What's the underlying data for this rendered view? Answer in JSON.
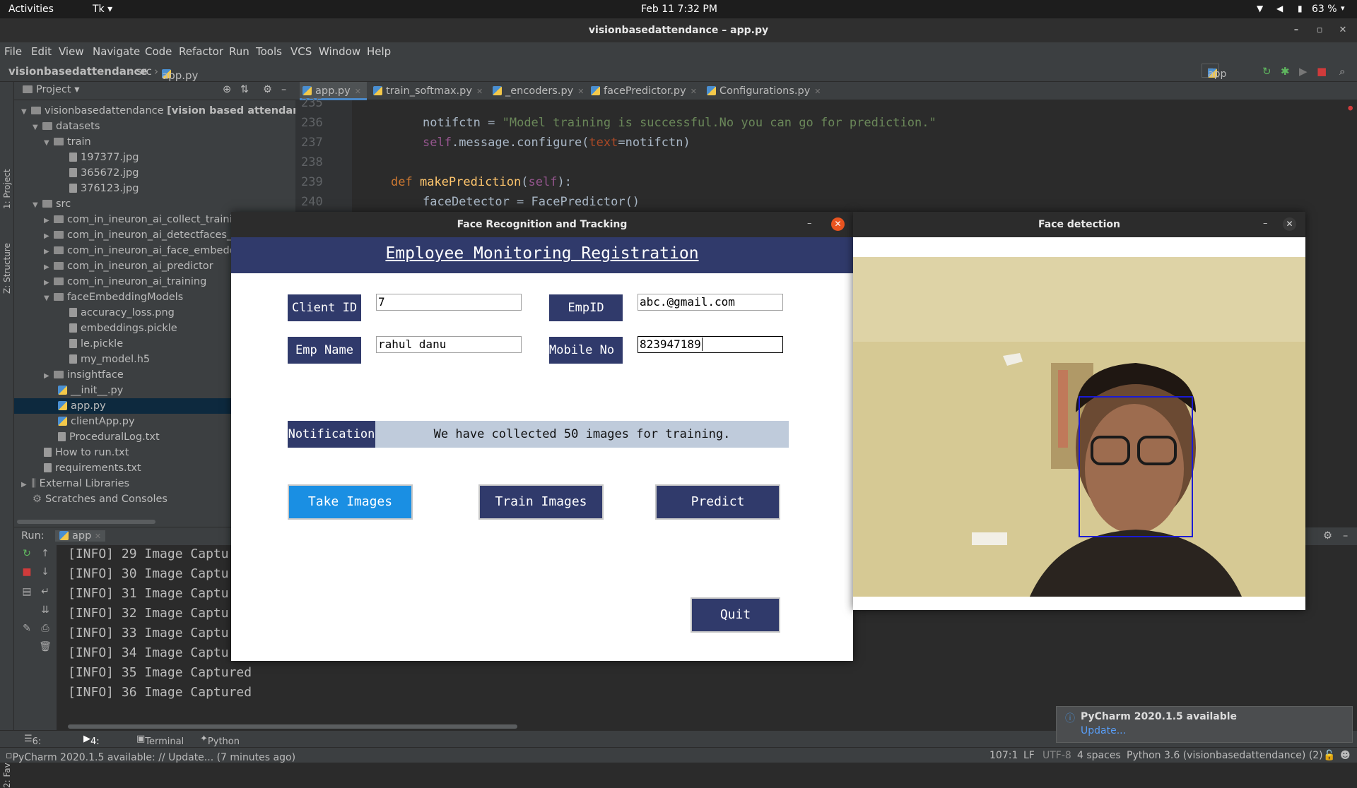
{
  "topbar": {
    "activities": "Activities",
    "app": "Tk",
    "datetime": "Feb 11  7:32 PM",
    "battery": "63 %"
  },
  "window": {
    "title": "visionbasedattendance – app.py"
  },
  "menu": [
    "File",
    "Edit",
    "View",
    "Navigate",
    "Code",
    "Refactor",
    "Run",
    "Tools",
    "VCS",
    "Window",
    "Help"
  ],
  "breadcrumb": {
    "project": "visionbasedattendance",
    "folder": "src",
    "file": "app.py",
    "run_config": "app"
  },
  "project_panel": {
    "title": "Project",
    "root": "visionbasedattendance",
    "root_suffix": "[vision based attendance]",
    "items": [
      {
        "label": "datasets"
      },
      {
        "label": "train"
      },
      {
        "label": "197377.jpg"
      },
      {
        "label": "365672.jpg"
      },
      {
        "label": "376123.jpg"
      },
      {
        "label": "src"
      },
      {
        "label": "com_in_ineuron_ai_collect_trainin"
      },
      {
        "label": "com_in_ineuron_ai_detectfaces_m"
      },
      {
        "label": "com_in_ineuron_ai_face_embedd"
      },
      {
        "label": "com_in_ineuron_ai_predictor"
      },
      {
        "label": "com_in_ineuron_ai_training"
      },
      {
        "label": "faceEmbeddingModels"
      },
      {
        "label": "accuracy_loss.png"
      },
      {
        "label": "embeddings.pickle"
      },
      {
        "label": "le.pickle"
      },
      {
        "label": "my_model.h5"
      },
      {
        "label": "insightface"
      },
      {
        "label": "__init__.py"
      },
      {
        "label": "app.py"
      },
      {
        "label": "clientApp.py"
      },
      {
        "label": "ProceduralLog.txt"
      },
      {
        "label": "How to run.txt"
      },
      {
        "label": "requirements.txt"
      },
      {
        "label": "External Libraries"
      },
      {
        "label": "Scratches and Consoles"
      }
    ]
  },
  "tabs": [
    "app.py",
    "train_softmax.py",
    "_encoders.py",
    "facePredictor.py",
    "Configurations.py"
  ],
  "editor": {
    "line_numbers": [
      "235",
      "236",
      "237",
      "238",
      "239",
      "240"
    ],
    "l236_var": "notifctn",
    "l236_eq": " = ",
    "l236_str": "\"Model training is successful.No you can go for prediction.\"",
    "l237_self": "self",
    "l237_mid": ".message.configure(",
    "l237_kw": "text",
    "l237_end": "=notifctn)",
    "l239_def": "def ",
    "l239_fn": "makePrediction",
    "l239_open": "(",
    "l239_self": "self",
    "l239_close": "):",
    "l240": "faceDetector = FacePredictor()"
  },
  "run_panel": {
    "label": "Run:",
    "config": "app",
    "lines": [
      "[INFO] 29 Image Captu",
      "[INFO] 30 Image Captu",
      "[INFO] 31 Image Captu",
      "[INFO] 32 Image Captu",
      "[INFO] 33 Image Captu",
      "[INFO] 34 Image Captu",
      "[INFO] 35 Image Captured",
      "[INFO] 36 Image Captured"
    ]
  },
  "bottom_tabs": [
    "6: TODO",
    "4: Run",
    "Terminal",
    "Python Console"
  ],
  "side_tabs": {
    "project": "1: Project",
    "structure": "Z: Structure",
    "favorites": "2: Favorites"
  },
  "status": {
    "message": "PyCharm 2020.1.5 available: // Update... (7 minutes ago)",
    "position": "107:1",
    "line_sep": "LF",
    "encoding": "UTF-8",
    "indent": "4 spaces",
    "interpreter": "Python 3.6 (visionbasedattendance) (2)"
  },
  "popup": {
    "title": "PyCharm 2020.1.5 available",
    "link": "Update..."
  },
  "tk_window": {
    "title": "Face Recognition and Tracking",
    "header": "Employee Monitoring Registration",
    "client_id_label": "Client ID",
    "client_id_value": "7",
    "empid_label": "EmpID",
    "empid_value": "abc.@gmail.com",
    "empname_label": "Emp Name",
    "empname_value": "rahul danu",
    "mobile_label": "Mobile No :",
    "mobile_value": "823947189",
    "notification_label": "Notification",
    "notification_text": "We have collected 50 images for training.",
    "take_images": "Take Images",
    "train_images": "Train Images",
    "predict": "Predict",
    "quit": "Quit"
  },
  "face_window": {
    "title": "Face detection"
  },
  "colors": {
    "tk_primary": "#303a6b",
    "take_images_active": "#1a8fe3",
    "detect_box": "#1a1ad6"
  }
}
